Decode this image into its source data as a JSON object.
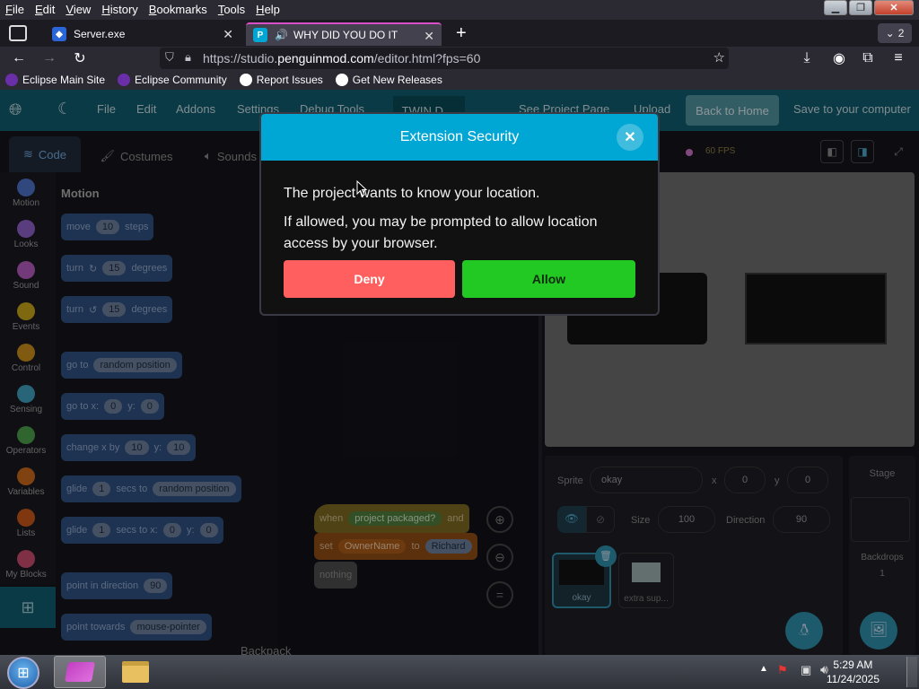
{
  "menubar": {
    "items": [
      "File",
      "Edit",
      "View",
      "History",
      "Bookmarks",
      "Tools",
      "Help"
    ]
  },
  "tabs": [
    {
      "title": "Server.exe",
      "icon": "dropbox-icon"
    },
    {
      "title": "WHY DID YOU DO IT",
      "icon": "penguinmod-icon",
      "audio": "speaker-icon"
    }
  ],
  "tab_count": "2",
  "url": {
    "prefix": "https://studio.",
    "domain": "penguinmod.com",
    "path": "/editor.html?fps=60"
  },
  "bookmarks": [
    "Eclipse Main Site",
    "Eclipse Community",
    "Report Issues",
    "Get New Releases"
  ],
  "appbar": {
    "file": "File",
    "edit": "Edit",
    "addons": "Addons",
    "settings": "Settings",
    "debug": "Debug Tools",
    "project_title": "TWIN D ...",
    "see_project": "See Project Page",
    "upload": "Upload",
    "back_home": "Back to Home",
    "save": "Save to your computer"
  },
  "editor_tabs": [
    "Code",
    "Costumes",
    "Sounds"
  ],
  "categories": [
    {
      "label": "Motion",
      "color": "#4c6fc4"
    },
    {
      "label": "Looks",
      "color": "#8a5fc4"
    },
    {
      "label": "Sound",
      "color": "#b05ab8"
    },
    {
      "label": "Events",
      "color": "#c4a21a"
    },
    {
      "label": "Control",
      "color": "#c48a1a"
    },
    {
      "label": "Sensing",
      "color": "#3e9bb8"
    },
    {
      "label": "Operators",
      "color": "#4a9b4a"
    },
    {
      "label": "Variables",
      "color": "#c4661a"
    },
    {
      "label": "Lists",
      "color": "#c4551a"
    },
    {
      "label": "My Blocks",
      "color": "#c44a6a"
    }
  ],
  "palette_heading": "Motion",
  "blocks": {
    "move": {
      "a": "move",
      "v": "10",
      "b": "steps"
    },
    "turn_r": {
      "a": "turn",
      "v": "15",
      "b": "degrees"
    },
    "turn_l": {
      "a": "turn",
      "v": "15",
      "b": "degrees"
    },
    "goto": {
      "a": "go to",
      "v": "random position"
    },
    "gotoxy": {
      "a": "go to x:",
      "x": "0",
      "y_label": "y:",
      "y": "0"
    },
    "changexy": {
      "a": "change x by",
      "x": "10",
      "y_label": "y:",
      "y": "10"
    },
    "glide": {
      "a": "glide",
      "v": "1",
      "b": "secs to",
      "c": "random position"
    },
    "glidexy": {
      "a": "glide",
      "v": "1",
      "b": "secs to x:",
      "x": "0",
      "y_label": "y:",
      "y": "0"
    },
    "point": {
      "a": "point in direction",
      "v": "90"
    },
    "towards": {
      "a": "point towards",
      "v": "mouse-pointer"
    }
  },
  "script": {
    "when": "when",
    "packaged": "project packaged?",
    "and": "and",
    "set": "set",
    "var": "OwnerName",
    "to": "to",
    "value": "Richard",
    "nothing": "nothing"
  },
  "backpack": "Backpack",
  "fps_label": "60 FPS",
  "sprite_info": {
    "sprite_label": "Sprite",
    "sprite_name": "okay",
    "x_label": "x",
    "x": "0",
    "y_label": "y",
    "y": "0",
    "size_label": "Size",
    "size": "100",
    "direction_label": "Direction",
    "direction": "90",
    "stage_label": "Stage",
    "backdrops_label": "Backdrops",
    "backdrops": "1"
  },
  "sprites": [
    "okay",
    "extra sup..."
  ],
  "modal": {
    "title": "Extension Security",
    "line1": "The project wants to know your location.",
    "line2": "If allowed, you may be prompted to allow location access by your browser.",
    "deny": "Deny",
    "allow": "Allow"
  },
  "clock": {
    "time": "5:29 AM",
    "date": "11/24/2025"
  }
}
